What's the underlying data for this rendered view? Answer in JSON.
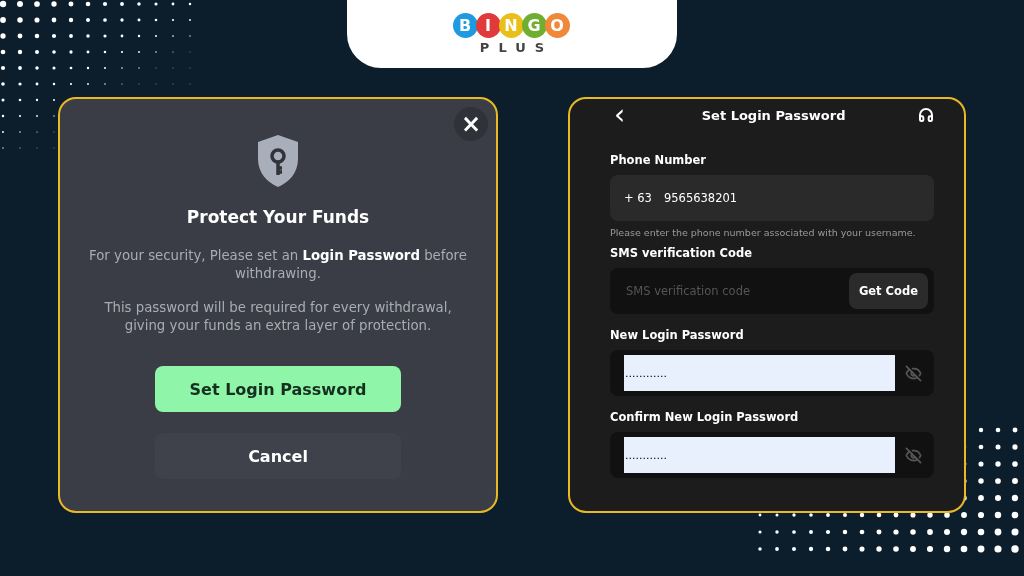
{
  "logo": {
    "letters": [
      {
        "char": "B",
        "color": "#1e9be0"
      },
      {
        "char": "I",
        "color": "#e03a3a"
      },
      {
        "char": "N",
        "color": "#e8c019"
      },
      {
        "char": "G",
        "color": "#6fae2f"
      },
      {
        "char": "O",
        "color": "#f0883a"
      }
    ],
    "subtitle": "PLUS"
  },
  "dialog": {
    "close": "×",
    "title": "Protect Your Funds",
    "message": "For your security, Please set an **Login Password** before withdrawing.",
    "note": "This password will be required for every withdrawal, giving your funds an extra layer of protection.",
    "buttons": [
      {
        "label": "Set Login Password",
        "kind": "primary"
      },
      {
        "label": "Cancel",
        "kind": "secondary"
      }
    ]
  },
  "form": {
    "back": "‹",
    "title": "Set Login Password",
    "fields": [
      {
        "kind": "phone",
        "label": "Phone Number",
        "prefix": "+ 63",
        "value": "9565638201",
        "hint": "Please enter the phone number associated with your username."
      },
      {
        "kind": "code",
        "label": "SMS verification Code",
        "placeholder": "SMS verification code",
        "button": "Get Code"
      },
      {
        "kind": "password",
        "label": "New Login Password",
        "value": "............"
      },
      {
        "kind": "password",
        "label": "Confirm New Login Password",
        "value": "............"
      }
    ]
  }
}
